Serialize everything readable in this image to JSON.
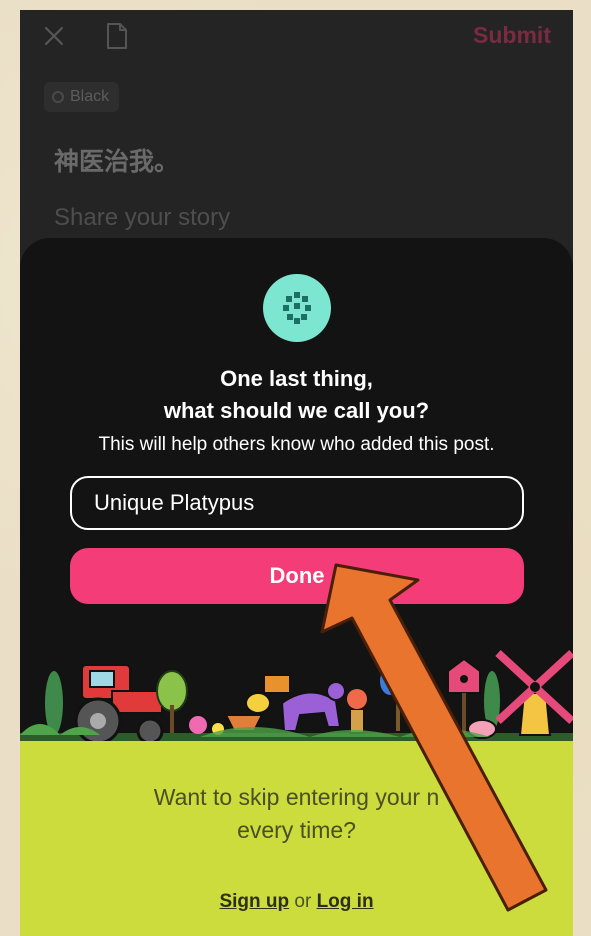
{
  "editor": {
    "submit_label": "Submit",
    "tag_label": "Black",
    "story_title": "神医治我。",
    "story_placeholder": "Share your story"
  },
  "sheet": {
    "heading_line1": "One last thing,",
    "heading_line2": "what should we call you?",
    "subtitle": "This will help others know who added this post.",
    "name_value": "Unique Platypus",
    "done_label": "Done"
  },
  "footer": {
    "skip_line1": "Want to skip entering your n",
    "skip_line2": "every time?",
    "signup_label": "Sign up",
    "or_text": "or",
    "login_label": "Log in"
  },
  "colors": {
    "accent_pink": "#f33c78",
    "logo_teal": "#7de6d0",
    "footer_lime": "#cbdc3c",
    "arrow_orange": "#e8742e"
  }
}
